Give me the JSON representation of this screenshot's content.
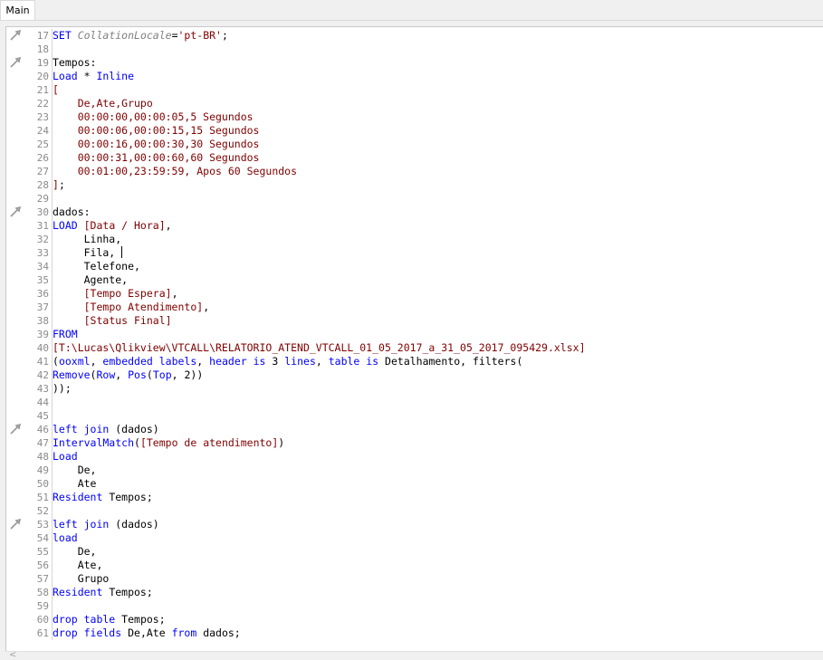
{
  "tabs": [
    {
      "label": "Main"
    }
  ],
  "editor": {
    "lines": [
      {
        "n": "17",
        "icon": true,
        "tokens": [
          [
            "kw",
            "SET "
          ],
          [
            "ital",
            "CollationLocale"
          ],
          [
            "plain",
            "="
          ],
          [
            "str",
            "'pt-BR'"
          ],
          [
            "plain",
            ";"
          ]
        ]
      },
      {
        "n": "18",
        "tokens": []
      },
      {
        "n": "19",
        "icon": true,
        "tokens": [
          [
            "plain",
            "Tempos:"
          ]
        ]
      },
      {
        "n": "20",
        "tokens": [
          [
            "kw",
            "Load"
          ],
          [
            "plain",
            " * "
          ],
          [
            "kw",
            "Inline"
          ]
        ]
      },
      {
        "n": "21",
        "tokens": [
          [
            "str",
            "["
          ]
        ]
      },
      {
        "n": "22",
        "tokens": [
          [
            "str",
            "    De,Ate,Grupo"
          ]
        ]
      },
      {
        "n": "23",
        "tokens": [
          [
            "str",
            "    00:00:00,00:00:05,5 Segundos"
          ]
        ]
      },
      {
        "n": "24",
        "tokens": [
          [
            "str",
            "    00:00:06,00:00:15,15 Segundos"
          ]
        ]
      },
      {
        "n": "25",
        "tokens": [
          [
            "str",
            "    00:00:16,00:00:30,30 Segundos"
          ]
        ]
      },
      {
        "n": "26",
        "tokens": [
          [
            "str",
            "    00:00:31,00:00:60,60 Segundos"
          ]
        ]
      },
      {
        "n": "27",
        "tokens": [
          [
            "str",
            "    00:01:00,23:59:59, Apos 60 Segundos"
          ]
        ]
      },
      {
        "n": "28",
        "tokens": [
          [
            "str",
            "]"
          ],
          [
            "plain",
            ";"
          ]
        ]
      },
      {
        "n": "29",
        "tokens": []
      },
      {
        "n": "30",
        "icon": true,
        "tokens": [
          [
            "plain",
            "dados:"
          ]
        ]
      },
      {
        "n": "31",
        "tokens": [
          [
            "kw",
            "LOAD "
          ],
          [
            "str",
            "[Data / Hora]"
          ],
          [
            "plain",
            ","
          ]
        ]
      },
      {
        "n": "32",
        "tokens": [
          [
            "plain",
            "     Linha,"
          ]
        ]
      },
      {
        "n": "33",
        "cursor": true,
        "tokens": [
          [
            "plain",
            "     Fila, "
          ]
        ]
      },
      {
        "n": "34",
        "tokens": [
          [
            "plain",
            "     Telefone,"
          ]
        ]
      },
      {
        "n": "35",
        "tokens": [
          [
            "plain",
            "     Agente,"
          ]
        ]
      },
      {
        "n": "36",
        "tokens": [
          [
            "plain",
            "     "
          ],
          [
            "str",
            "[Tempo Espera]"
          ],
          [
            "plain",
            ","
          ]
        ]
      },
      {
        "n": "37",
        "tokens": [
          [
            "plain",
            "     "
          ],
          [
            "str",
            "[Tempo Atendimento]"
          ],
          [
            "plain",
            ","
          ]
        ]
      },
      {
        "n": "38",
        "tokens": [
          [
            "plain",
            "     "
          ],
          [
            "str",
            "[Status Final]"
          ]
        ]
      },
      {
        "n": "39",
        "tokens": [
          [
            "kw",
            "FROM"
          ]
        ]
      },
      {
        "n": "40",
        "tokens": [
          [
            "str",
            "[T:\\Lucas\\Qlikview\\VTCALL\\RELATORIO_ATEND_VTCALL_01_05_2017_a_31_05_2017_095429.xlsx]"
          ]
        ]
      },
      {
        "n": "41",
        "tokens": [
          [
            "plain",
            "("
          ],
          [
            "kw",
            "ooxml"
          ],
          [
            "plain",
            ", "
          ],
          [
            "kw",
            "embedded labels"
          ],
          [
            "plain",
            ", "
          ],
          [
            "kw",
            "header is "
          ],
          [
            "plain",
            "3 "
          ],
          [
            "kw",
            "lines"
          ],
          [
            "plain",
            ", "
          ],
          [
            "kw",
            "table is "
          ],
          [
            "plain",
            "Detalhamento, filters("
          ]
        ]
      },
      {
        "n": "42",
        "tokens": [
          [
            "kw",
            "Remove"
          ],
          [
            "plain",
            "("
          ],
          [
            "kw",
            "Row"
          ],
          [
            "plain",
            ", "
          ],
          [
            "kw",
            "Pos"
          ],
          [
            "plain",
            "("
          ],
          [
            "kw",
            "Top"
          ],
          [
            "plain",
            ", 2))"
          ]
        ]
      },
      {
        "n": "43",
        "tokens": [
          [
            "plain",
            "));"
          ]
        ]
      },
      {
        "n": "44",
        "tokens": []
      },
      {
        "n": "45",
        "tokens": []
      },
      {
        "n": "46",
        "icon": true,
        "tokens": [
          [
            "kw",
            "left join "
          ],
          [
            "plain",
            "(dados)"
          ]
        ]
      },
      {
        "n": "47",
        "tokens": [
          [
            "kw",
            "IntervalMatch"
          ],
          [
            "plain",
            "("
          ],
          [
            "str",
            "[Tempo de atendimento]"
          ],
          [
            "plain",
            ")"
          ]
        ]
      },
      {
        "n": "48",
        "tokens": [
          [
            "kw",
            "Load"
          ]
        ]
      },
      {
        "n": "49",
        "tokens": [
          [
            "plain",
            "    De,"
          ]
        ]
      },
      {
        "n": "50",
        "tokens": [
          [
            "plain",
            "    Ate"
          ]
        ]
      },
      {
        "n": "51",
        "tokens": [
          [
            "kw",
            "Resident "
          ],
          [
            "plain",
            "Tempos;"
          ]
        ]
      },
      {
        "n": "52",
        "tokens": []
      },
      {
        "n": "53",
        "icon": true,
        "tokens": [
          [
            "kw",
            "left join "
          ],
          [
            "plain",
            "(dados)"
          ]
        ]
      },
      {
        "n": "54",
        "tokens": [
          [
            "kw",
            "load"
          ]
        ]
      },
      {
        "n": "55",
        "tokens": [
          [
            "plain",
            "    De,"
          ]
        ]
      },
      {
        "n": "56",
        "tokens": [
          [
            "plain",
            "    Ate,"
          ]
        ]
      },
      {
        "n": "57",
        "tokens": [
          [
            "plain",
            "    Grupo"
          ]
        ]
      },
      {
        "n": "58",
        "tokens": [
          [
            "kw",
            "Resident "
          ],
          [
            "plain",
            "Tempos;"
          ]
        ]
      },
      {
        "n": "59",
        "tokens": []
      },
      {
        "n": "60",
        "tokens": [
          [
            "kw",
            "drop table "
          ],
          [
            "plain",
            "Tempos;"
          ]
        ]
      },
      {
        "n": "61",
        "tokens": [
          [
            "kw",
            "drop fields "
          ],
          [
            "plain",
            "De,Ate "
          ],
          [
            "kw",
            "from "
          ],
          [
            "plain",
            "dados;"
          ]
        ]
      }
    ]
  },
  "scrollbar": {
    "left_arrow": "<"
  }
}
